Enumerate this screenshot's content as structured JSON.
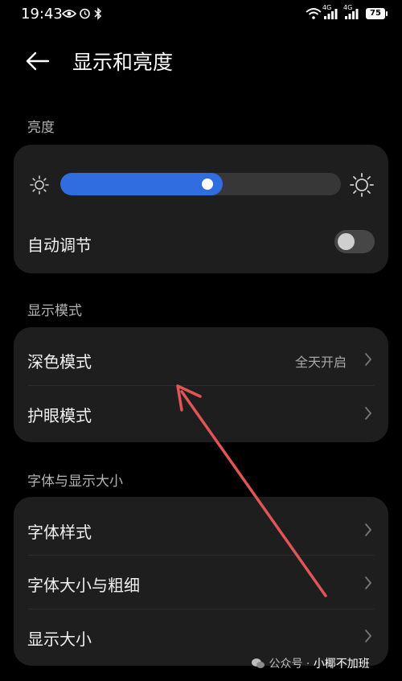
{
  "status_bar": {
    "time": "19:43",
    "signal_label_1": "4G",
    "signal_label_2": "4G",
    "battery": "75"
  },
  "header": {
    "title": "显示和亮度"
  },
  "brightness": {
    "section_label": "亮度",
    "level": 0.54,
    "auto_label": "自动调节",
    "auto_enabled": false
  },
  "display_mode": {
    "section_label": "显示模式",
    "items": [
      {
        "label": "深色模式",
        "value": "全天开启"
      },
      {
        "label": "护眼模式",
        "value": ""
      }
    ]
  },
  "font_display": {
    "section_label": "字体与显示大小",
    "items": [
      {
        "label": "字体样式"
      },
      {
        "label": "字体大小与粗细"
      },
      {
        "label": "显示大小"
      }
    ]
  },
  "watermark": {
    "prefix": "公众号 · ",
    "brand": "小椰不加班"
  },
  "colors": {
    "accent": "#2f6de0",
    "annotation_arrow": "#e05555",
    "card": "#1e1e1e"
  }
}
